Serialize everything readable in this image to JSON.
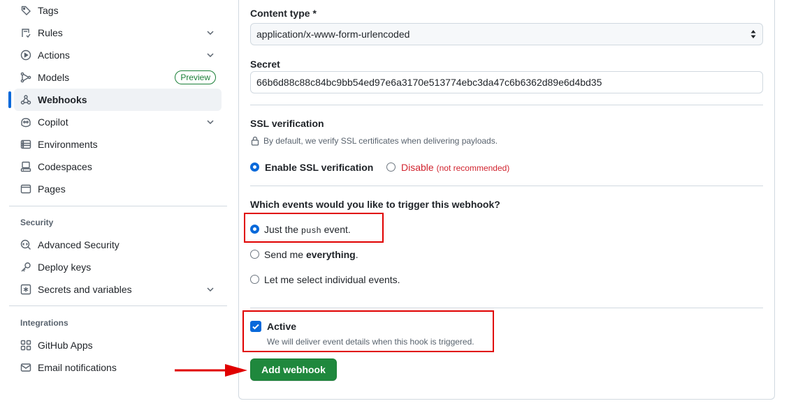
{
  "sidebar": {
    "items": [
      {
        "label": "Tags"
      },
      {
        "label": "Rules"
      },
      {
        "label": "Actions"
      },
      {
        "label": "Models",
        "badge": "Preview"
      },
      {
        "label": "Webhooks"
      },
      {
        "label": "Copilot"
      },
      {
        "label": "Environments"
      },
      {
        "label": "Codespaces"
      },
      {
        "label": "Pages"
      }
    ],
    "security_heading": "Security",
    "security_items": [
      {
        "label": "Advanced Security"
      },
      {
        "label": "Deploy keys"
      },
      {
        "label": "Secrets and variables"
      }
    ],
    "integrations_heading": "Integrations",
    "integrations_items": [
      {
        "label": "GitHub Apps"
      },
      {
        "label": "Email notifications"
      }
    ]
  },
  "form": {
    "content_type_label": "Content type *",
    "content_type_value": "application/x-www-form-urlencoded",
    "secret_label": "Secret",
    "secret_value": "66b6d88c88c84bc9bb54ed97e6a3170e513774ebc3da47c6b6362d89e6d4bd35",
    "ssl_heading": "SSL verification",
    "ssl_note": "By default, we verify SSL certificates when delivering payloads.",
    "ssl_enable_label": "Enable SSL verification",
    "ssl_disable_label": "Disable",
    "ssl_disable_note": "(not recommended)",
    "events_heading": "Which events would you like to trigger this webhook?",
    "event_push_prefix": "Just the",
    "event_push_code": "push",
    "event_push_suffix": "event.",
    "event_everything_prefix": "Send me",
    "event_everything_bold": "everything",
    "event_everything_suffix": ".",
    "event_select_label": "Let me select individual events.",
    "active_label": "Active",
    "active_note": "We will deliver event details when this hook is triggered.",
    "submit_label": "Add webhook"
  },
  "colors": {
    "accent": "#0969da",
    "primary_button": "#1f883d",
    "danger": "#d1242f",
    "annotation": "#e00000"
  }
}
